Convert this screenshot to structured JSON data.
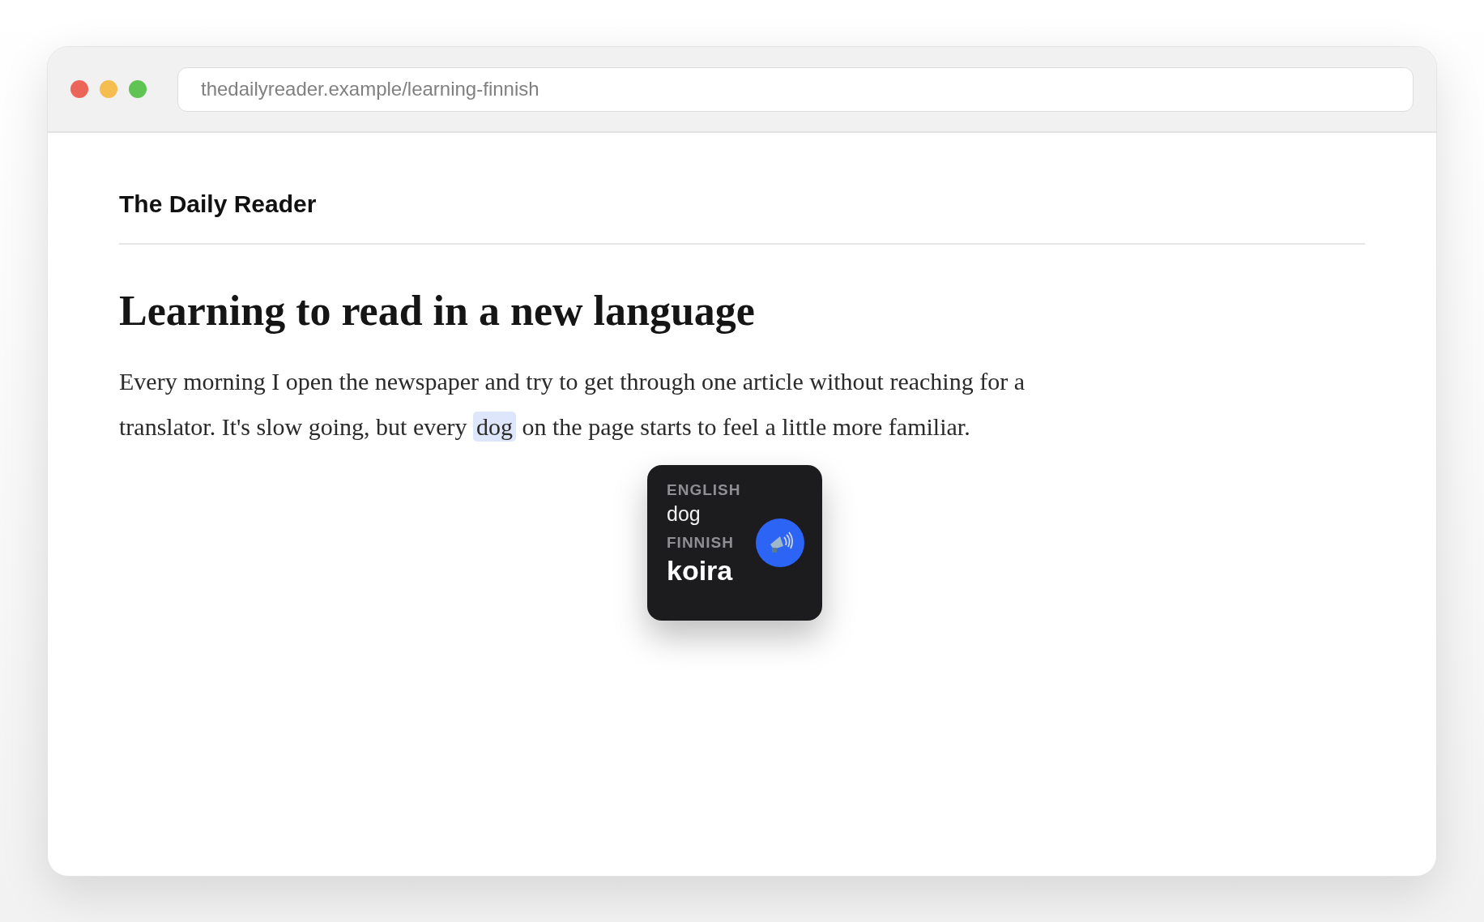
{
  "browser": {
    "url": "thedailyreader.example/learning-finnish"
  },
  "site": {
    "name": "The Daily Reader"
  },
  "article": {
    "title": "Learning to read in a new language",
    "paragraph": {
      "before": "Every morning I open the newspaper and try to get through one article without reaching for a translator. It's slow going, but every",
      "highlight": "dog",
      "after": "on the page starts to feel a little more familiar."
    }
  },
  "popup": {
    "source_label": "ENGLISH",
    "source_word": "dog",
    "target_label": "FINNISH",
    "target_word": "koira"
  }
}
